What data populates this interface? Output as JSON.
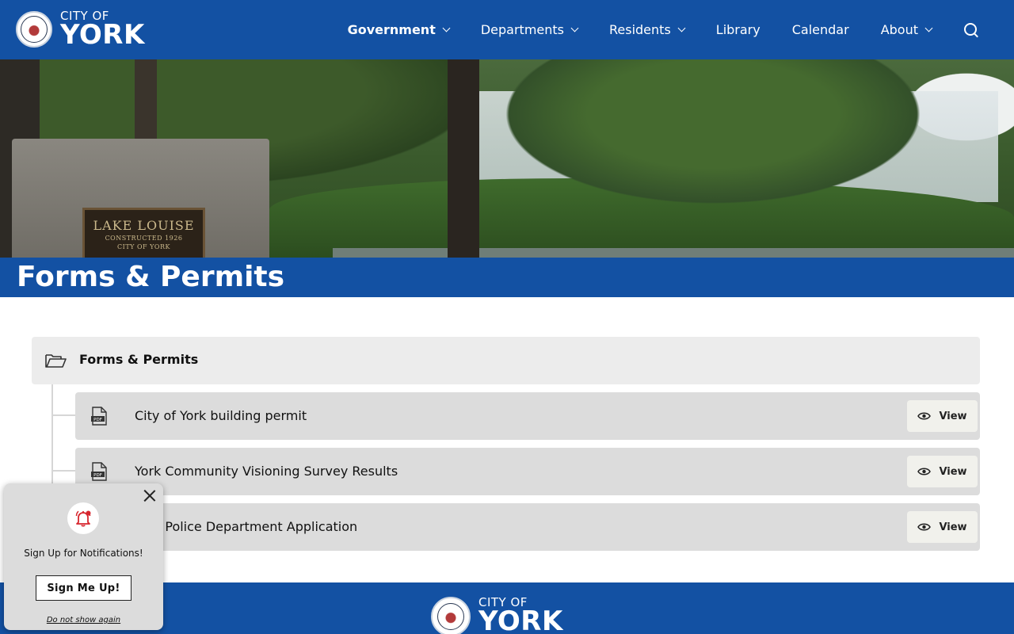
{
  "header": {
    "logo_city": "CITY OF",
    "logo_name": "YORK",
    "nav": [
      {
        "label": "Government",
        "dropdown": true,
        "active": true
      },
      {
        "label": "Departments",
        "dropdown": true
      },
      {
        "label": "Residents",
        "dropdown": true
      },
      {
        "label": "Library",
        "dropdown": false
      },
      {
        "label": "Calendar",
        "dropdown": false
      },
      {
        "label": "About",
        "dropdown": true
      }
    ],
    "search_icon": "search-icon",
    "colors": {
      "brand": "#1351a3"
    }
  },
  "hero": {
    "sign_title": "LAKE LOUISE",
    "sign_line1": "CONSTRUCTED 1926",
    "sign_line2": "CITY OF YORK"
  },
  "page": {
    "title": "Forms & Permits"
  },
  "folder": {
    "label": "Forms & Permits",
    "icon": "folder-open-icon"
  },
  "documents": [
    {
      "label": "City of York building permit",
      "icon": "pdf-file-icon",
      "action": "View"
    },
    {
      "label": "York Community Visioning Survey Results",
      "icon": "pdf-file-icon",
      "action": "View"
    },
    {
      "label": "York Police Department Application",
      "icon": "pdf-file-icon",
      "action": "View"
    }
  ],
  "footer": {
    "logo_city": "CITY OF",
    "logo_name": "YORK"
  },
  "notification": {
    "text": "Sign Up for Notifications!",
    "button": "Sign Me Up!",
    "dismiss": "Do not show again",
    "bell_color": "#d7262e"
  }
}
